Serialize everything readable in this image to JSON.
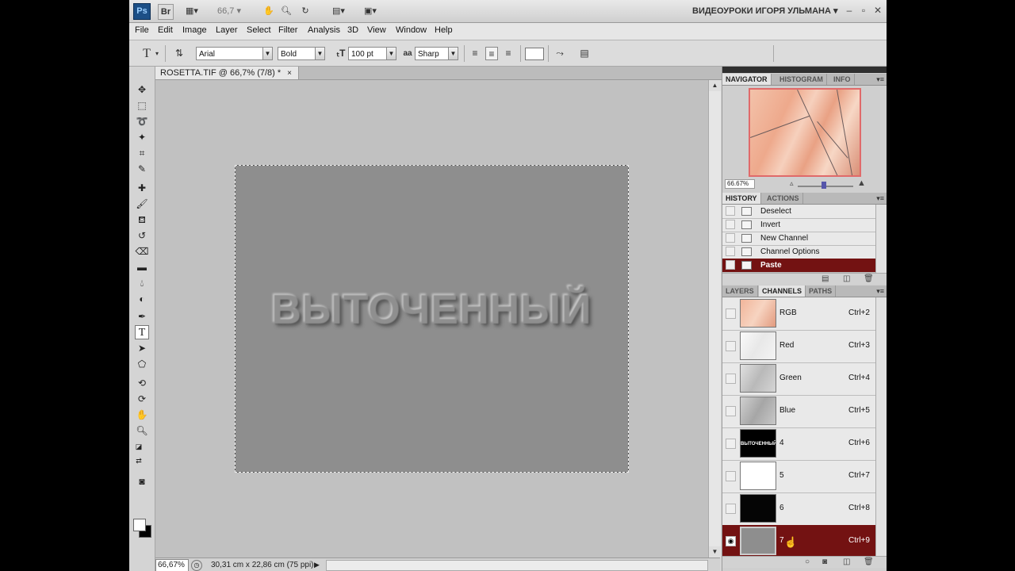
{
  "appbar": {
    "logo": "Ps",
    "bridge": "Br",
    "zoom": "66,7",
    "workspace": "ВИДЕОУРОКИ ИГОРЯ УЛЬМАНА",
    "dropdown_icon": "chevron-down-icon"
  },
  "menu": [
    "File",
    "Edit",
    "Image",
    "Layer",
    "Select",
    "Filter",
    "Analysis",
    "3D",
    "View",
    "Window",
    "Help"
  ],
  "options": {
    "tool_glyph": "T",
    "font_family": "Arial",
    "font_style": "Bold",
    "font_size": "100 pt",
    "aa_label": "aa",
    "antialias": "Sharp"
  },
  "document": {
    "tab_title": "ROSETTA.TIF @ 66,7% (7/8) *",
    "close": "×",
    "canvas_text": "ВЫТОЧЕННЫЙ",
    "zoom_status": "66,67%",
    "doc_info": "30,31 cm x 22,86 cm (75 ppi)"
  },
  "navigator": {
    "tabs": [
      "NAVIGATOR",
      "HISTOGRAM",
      "INFO"
    ],
    "zoom": "66.67%"
  },
  "history": {
    "tabs": [
      "HISTORY",
      "ACTIONS"
    ],
    "items": [
      "Deselect",
      "Invert",
      "New Channel",
      "Channel Options",
      "Paste"
    ],
    "selected_index": 4
  },
  "channels": {
    "tabs": [
      "LAYERS",
      "CHANNELS",
      "PATHS"
    ],
    "items": [
      {
        "name": "RGB",
        "shortcut": "Ctrl+2"
      },
      {
        "name": "Red",
        "shortcut": "Ctrl+3"
      },
      {
        "name": "Green",
        "shortcut": "Ctrl+4"
      },
      {
        "name": "Blue",
        "shortcut": "Ctrl+5"
      },
      {
        "name": "4",
        "shortcut": "Ctrl+6",
        "thumb_text": "ВЫТОЧЕННЫЙ"
      },
      {
        "name": "5",
        "shortcut": "Ctrl+7"
      },
      {
        "name": "6",
        "shortcut": "Ctrl+8"
      },
      {
        "name": "7",
        "shortcut": "Ctrl+9"
      }
    ],
    "selected_index": 7
  },
  "colors": {
    "selection": "#731212",
    "canvas": "#8e8e8e"
  }
}
